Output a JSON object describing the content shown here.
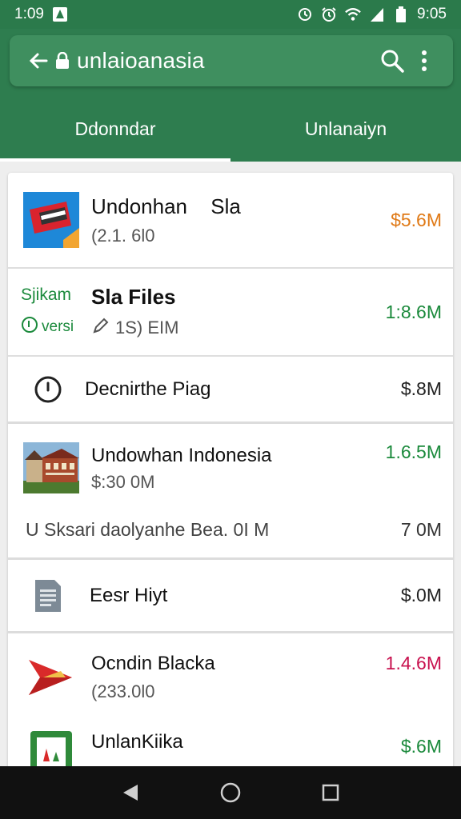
{
  "status_bar": {
    "time_left": "1:09",
    "time_right": "9:05"
  },
  "app_bar": {
    "url_text": "unlaioanasia"
  },
  "tabs": [
    {
      "label": "Ddonndar",
      "active": true
    },
    {
      "label": "Unlanaiyn",
      "active": false
    }
  ],
  "items": [
    {
      "title": "Undonhan",
      "title_suffix": "Sla",
      "subtitle": "(2.1. 6l0",
      "size": "$5.6M",
      "size_color": "#e07a17",
      "icon": "red-folder-icon"
    },
    {
      "label_top": "Sjikam",
      "label_bottom": "versi",
      "title": "Sla Files",
      "subtitle": "1S) EIM",
      "size": "1:8.6M",
      "size_color": "#1b8a3c",
      "icon": "pencil-icon"
    },
    {
      "title": "Decnirthe Piag",
      "size": "$.8M",
      "size_color": "#222222",
      "icon": "clock-icon"
    },
    {
      "title": "Undowhan Indonesia",
      "subtitle": "$:30 0M",
      "size": "1.6.5M",
      "size_color": "#1b8a3c",
      "icon": "house-photo-icon"
    },
    {
      "title": "U Sksari daolyanhe Bea. 0I M",
      "size": "7 0M",
      "size_color": "#222222"
    },
    {
      "title": "Eesr Hiyt",
      "size": "$.0M",
      "size_color": "#222222",
      "icon": "document-icon"
    },
    {
      "title": "Ocndin Blacka",
      "subtitle": "(233.0l0",
      "size": "1.4.6M",
      "size_color": "#c8124f",
      "icon": "red-arrow-icon"
    },
    {
      "title": "UnlanKiika",
      "size": "$.6M",
      "size_color": "#1b8a3c",
      "icon": "green-app-icon"
    }
  ]
}
